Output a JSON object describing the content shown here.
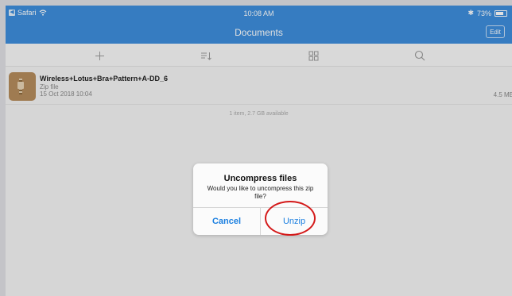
{
  "status_bar": {
    "carrier": "Safari",
    "time": "10:08 AM",
    "battery": "73%"
  },
  "nav": {
    "title": "Documents",
    "edit_label": "Edit"
  },
  "toolbar": {
    "icons": [
      "plus-icon",
      "sort-icon",
      "grid-icon",
      "search-icon"
    ]
  },
  "file": {
    "name": "Wireless+Lotus+Bra+Pattern+A-DD_6",
    "type": "Zip file",
    "date": "15 Oct 2018 10:04",
    "size": "4.5 MB"
  },
  "storage_info": "1 item, 2.7 GB available",
  "dialog": {
    "title": "Uncompress files",
    "message": "Would you like to uncompress this zip file?",
    "cancel_label": "Cancel",
    "unzip_label": "Unzip"
  },
  "colors": {
    "accent": "#3e8edc",
    "button_text": "#1a7fe0",
    "annotation": "#d41a1a"
  }
}
